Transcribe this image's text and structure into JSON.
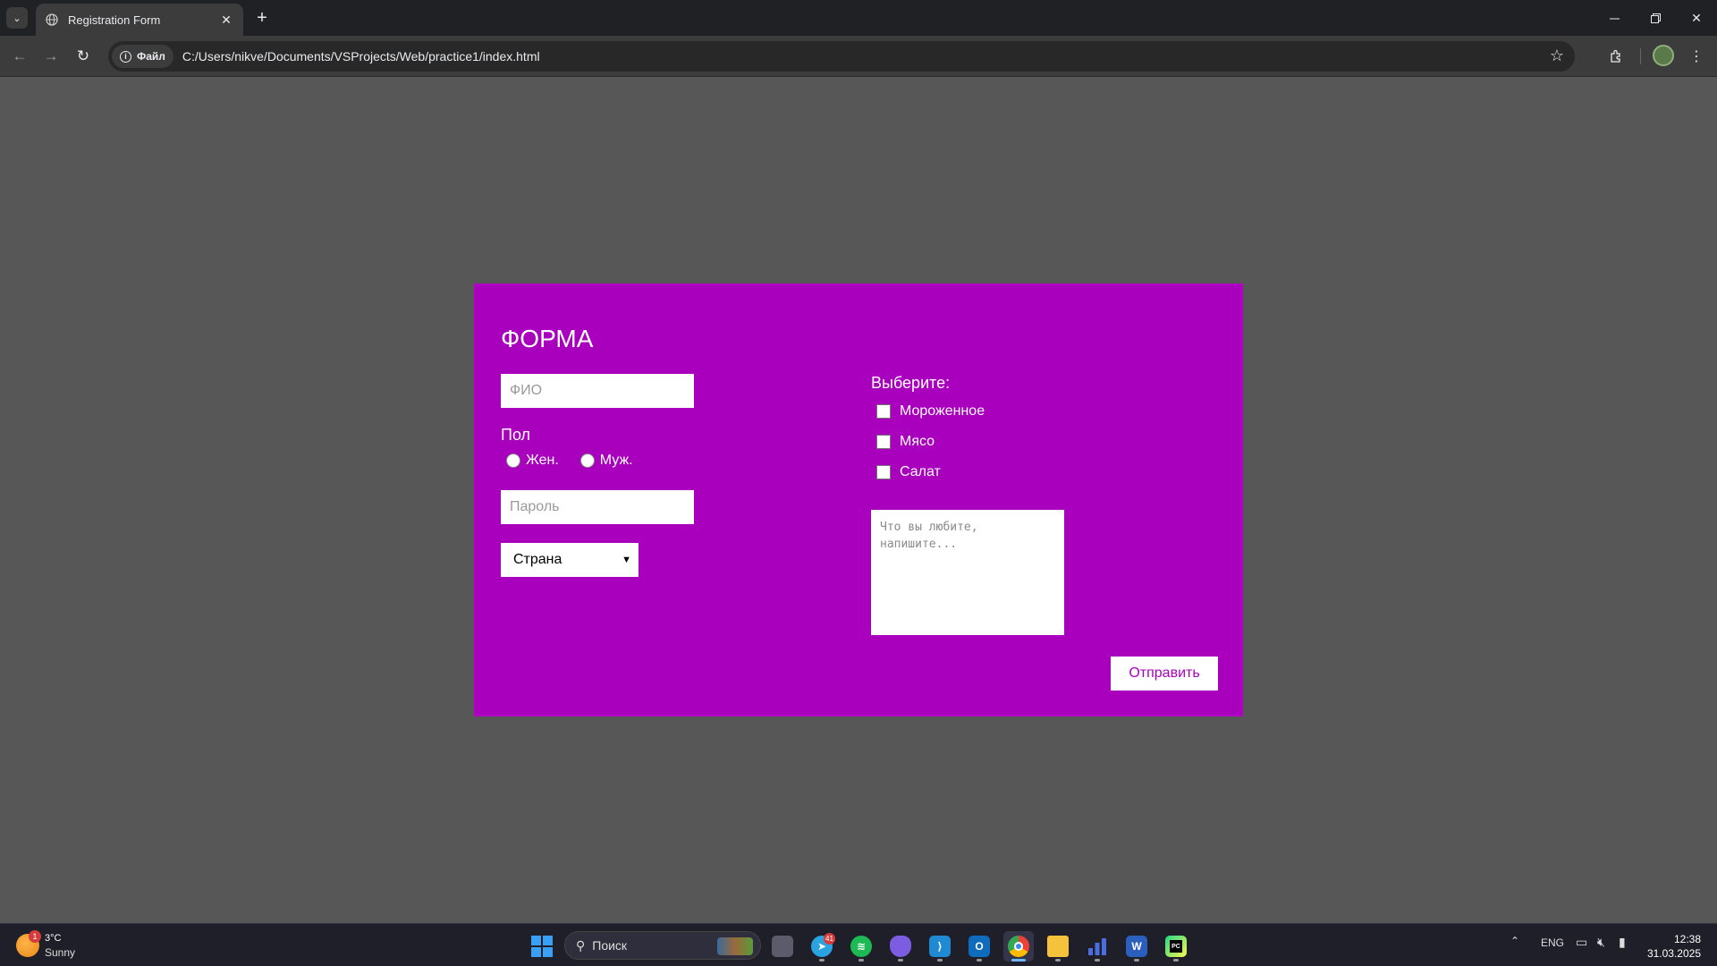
{
  "browser": {
    "tab_title": "Registration Form",
    "site_chip": "Файл",
    "url": "C:/Users/nikve/Documents/VSProjects/Web/practice1/index.html"
  },
  "form": {
    "title": "ФОРМА",
    "fio_placeholder": "ФИО",
    "gender_label": "Пол",
    "gender_options": [
      "Жен.",
      "Муж."
    ],
    "password_placeholder": "Пароль",
    "country_selected": "Страна",
    "choose_label": "Выберите:",
    "food_options": [
      "Мороженное",
      "Мясо",
      "Салат"
    ],
    "textarea_placeholder": "Что вы любите,\nнапишите...",
    "submit_label": "Отправить",
    "background_color": "#a800bd"
  },
  "taskbar": {
    "weather_badge": "1",
    "weather_temp": "3°C",
    "weather_condition": "Sunny",
    "search_placeholder": "Поиск",
    "telegram_badge": "41",
    "language": "ENG",
    "time": "12:38",
    "date": "31.03.2025",
    "apps": [
      "file-explorer-icon",
      "telegram-icon",
      "spotify-icon",
      "obsidian-icon",
      "vscode-icon",
      "outlook-icon",
      "chrome-icon",
      "folder-icon",
      "chart-app-icon",
      "word-icon",
      "pycharm-icon"
    ]
  }
}
